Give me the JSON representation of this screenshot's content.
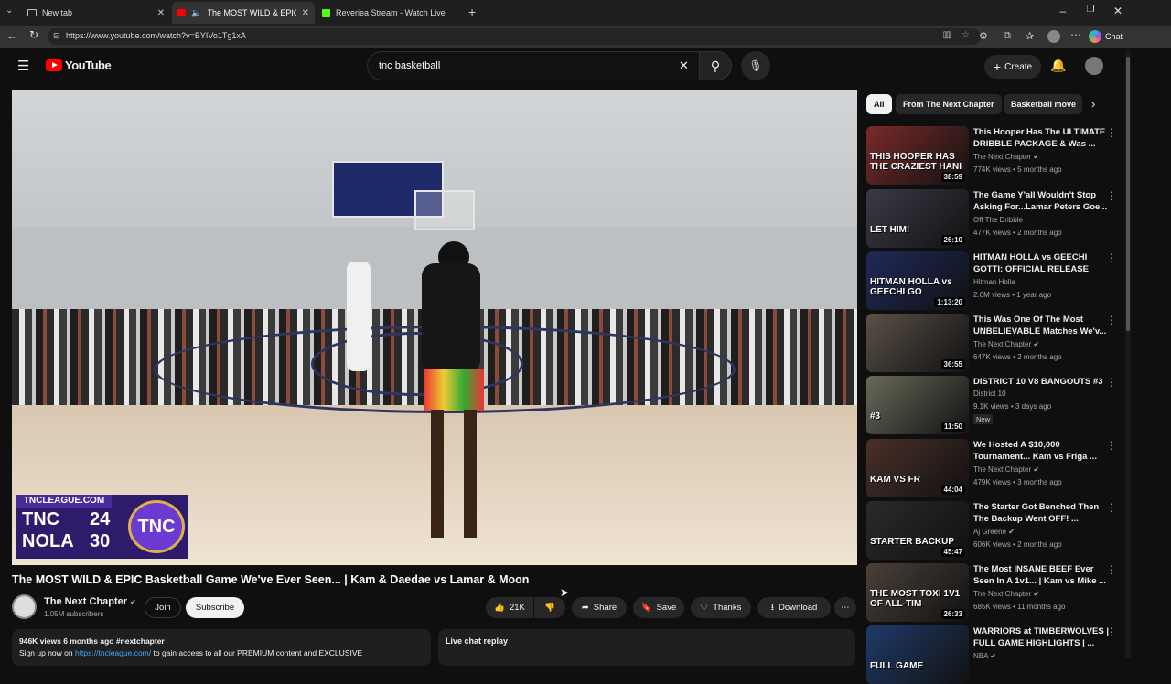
{
  "browser": {
    "tabs": [
      {
        "title": "New tab"
      },
      {
        "title": "The MOST WILD & EPIC Baskı"
      },
      {
        "title": "Reveriea Stream - Watch Live on K"
      }
    ],
    "url": "https://www.youtube.com/watch?v=BYIVo1Tg1xA",
    "chat_label": "Chat"
  },
  "yt": {
    "logo_text": "YouTube",
    "search_value": "tnc basketball",
    "create_label": "Create"
  },
  "video": {
    "overlay_site": "TNCLEAGUE.COM",
    "team1": "TNC",
    "score1": "24",
    "team2": "NOLA",
    "score2": "30",
    "logo_text": "TNC",
    "title": "The MOST WILD & EPIC Basketball Game We've Ever Seen... | Kam & Daedae vs Lamar & Moon",
    "channel": "The Next Chapter",
    "subscribers": "1.05M subscribers",
    "join_label": "Join",
    "subscribe_label": "Subscribe",
    "likes": "21K",
    "share_label": "Share",
    "save_label": "Save",
    "thanks_label": "Thanks",
    "download_label": "Download",
    "desc_meta": "946K views  6 months ago  #nextchapter",
    "desc_text_pre": "Sign up now on ",
    "desc_link": "https://tncleague.com/",
    "desc_text_post": " to gain access to all our PREMIUM content and EXCLUSIVE",
    "live_chat_label": "Live chat replay"
  },
  "chips": [
    "All",
    "From The Next Chapter",
    "Basketball move"
  ],
  "recommendations": [
    {
      "title": "This Hooper Has The ULTIMATE\nDRIBBLE PACKAGE & Was ...",
      "channel": "The Next Chapter",
      "verified": true,
      "meta": "774K views • 5 months ago",
      "duration": "38:59",
      "thumb_color": "#7a2a2a",
      "thumb_text": "THIS HOOPER HAS THE CRAZIEST HANI"
    },
    {
      "title": "The Game Y'all Wouldn't Stop\nAsking For...Lamar Peters Goe...",
      "channel": "Off The Dribble",
      "verified": false,
      "meta": "477K views • 2 months ago",
      "duration": "26:10",
      "thumb_color": "#3a3a48",
      "thumb_text": "LET HIM!"
    },
    {
      "title": "HITMAN HOLLA vs GEECHI\nGOTTI: OFFICIAL RELEASE",
      "channel": "Hitman Holla",
      "verified": false,
      "meta": "2.6M views • 1 year ago",
      "duration": "1:13:20",
      "thumb_color": "#1f2a5a",
      "thumb_text": "HITMAN HOLLA vs GEECHI GO"
    },
    {
      "title": "This Was One Of The Most\nUNBELIEVABLE Matches We'v...",
      "channel": "The Next Chapter",
      "verified": true,
      "meta": "647K views • 2 months ago",
      "duration": "36:55",
      "thumb_color": "#5a5048",
      "thumb_text": ""
    },
    {
      "title": "DISTRICT 10 V8 BANGOUTS #3",
      "channel": "District 10",
      "verified": false,
      "meta": "9.1K views • 3 days ago",
      "duration": "11:50",
      "thumb_color": "#6a6a5a",
      "thumb_text": "#3",
      "badge": "New"
    },
    {
      "title": "We Hosted A $10,000\nTournament... Kam vs Friga ...",
      "channel": "The Next Chapter",
      "verified": true,
      "meta": "479K views • 3 months ago",
      "duration": "44:04",
      "thumb_color": "#4a3028",
      "thumb_text": "KAM VS FR"
    },
    {
      "title": "The Starter Got Benched Then\nThe Backup Went OFF! ...",
      "channel": "Aj Greene",
      "verified": true,
      "meta": "606K views • 2 months ago",
      "duration": "45:47",
      "thumb_color": "#2a2a2a",
      "thumb_text": "STARTER  BACKUP"
    },
    {
      "title": "The Most INSANE BEEF Ever\nSeen In A 1v1... | Kam vs Mike ...",
      "channel": "The Next Chapter",
      "verified": true,
      "meta": "685K views • 11 months ago",
      "duration": "26:33",
      "thumb_color": "#4a4038",
      "thumb_text": "THE MOST TOXI 1V1 OF ALL-TIM"
    },
    {
      "title": "WARRIORS at TIMBERWOLVES |\nFULL GAME HIGHLIGHTS | ...",
      "channel": "NBA",
      "verified": true,
      "meta": "",
      "duration": "",
      "thumb_color": "#1f3a6a",
      "thumb_text": "FULL GAME"
    }
  ]
}
